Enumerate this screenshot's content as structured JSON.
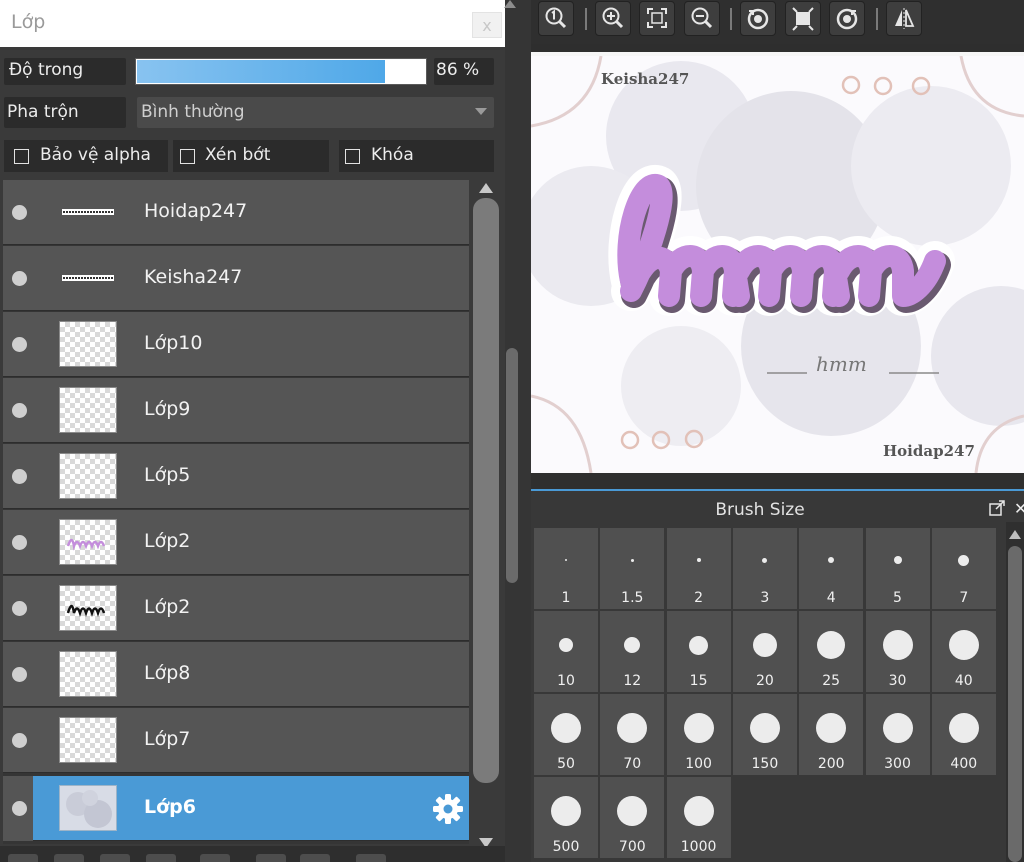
{
  "layer_panel": {
    "title": "Lớp",
    "close_label": "x",
    "opacity": {
      "label": "Độ trong",
      "percent": 86,
      "value_text": "86 %"
    },
    "blend": {
      "label": "Pha trộn",
      "value": "Bình thường"
    },
    "options": {
      "protect_alpha": "Bảo vệ alpha",
      "clip": "Xén bớt",
      "lock": "Khóa"
    },
    "layers": [
      {
        "name": "Hoidap247",
        "thumb": "text-strip",
        "selected": false
      },
      {
        "name": "Keisha247",
        "thumb": "text-strip",
        "selected": false
      },
      {
        "name": "Lớp10",
        "thumb": "transparent",
        "selected": false
      },
      {
        "name": "Lớp9",
        "thumb": "transparent",
        "selected": false
      },
      {
        "name": "Lớp5",
        "thumb": "transparent",
        "selected": false
      },
      {
        "name": "Lớp2",
        "thumb": "hmm-purple",
        "selected": false
      },
      {
        "name": "Lớp2",
        "thumb": "hmm-black",
        "selected": false
      },
      {
        "name": "Lớp8",
        "thumb": "transparent",
        "selected": false
      },
      {
        "name": "Lớp7",
        "thumb": "transparent",
        "selected": false
      },
      {
        "name": "Lớp6",
        "thumb": "bubbles",
        "selected": true
      }
    ]
  },
  "toolbar": {
    "buttons": [
      "zoom-actual-icon",
      "zoom-in-icon",
      "fit-screen-icon",
      "zoom-out-icon",
      "rotate-left-icon",
      "fullscreen-icon",
      "rotate-right-icon",
      "flip-icon"
    ]
  },
  "canvas": {
    "watermark_top": "Keisha247",
    "watermark_bottom": "Hoidap247",
    "main_word": "hmm",
    "small_word": "hmm",
    "accent": "#c48ddc"
  },
  "brush_panel": {
    "title": "Brush Size",
    "sizes": [
      "1",
      "1.5",
      "2",
      "3",
      "4",
      "5",
      "7",
      "10",
      "12",
      "15",
      "20",
      "25",
      "30",
      "40",
      "50",
      "70",
      "100",
      "150",
      "200",
      "300",
      "400",
      "500",
      "700",
      "1000"
    ]
  },
  "colors": {
    "selection": "#4a9ad6",
    "panel": "#555555",
    "background": "#2e2e2e"
  }
}
